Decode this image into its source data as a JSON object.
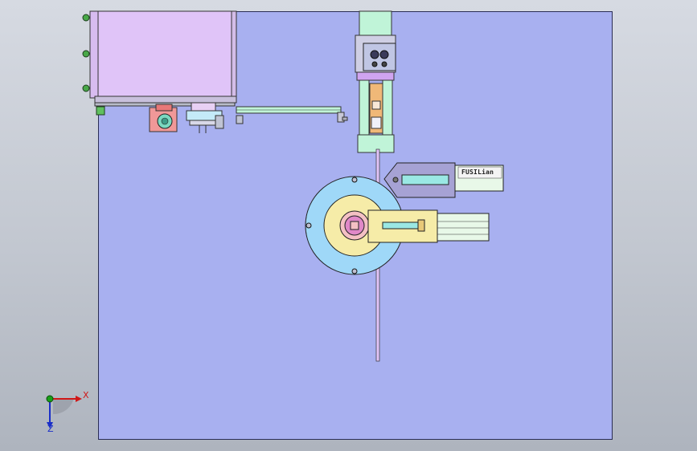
{
  "triad": {
    "x_label": "X",
    "y_label": "Z"
  },
  "cylinder_brand": "FUSILian",
  "colors": {
    "background": "#c8ccd4",
    "plate": "#a8b0f0",
    "enclosure": "#e0c4f8",
    "flange": "#9fd8f8",
    "cam": "#f6eca8",
    "hub": "#f4c0c4",
    "rail": "#c0f4d8",
    "slider": "#f0b878",
    "cylinder_body": "#a6a2d4",
    "rod": "#9ae8e4",
    "sensor": "#f09898",
    "axis_x": "#d01818",
    "axis_y": "#18a018",
    "axis_z": "#1a2ec8"
  }
}
